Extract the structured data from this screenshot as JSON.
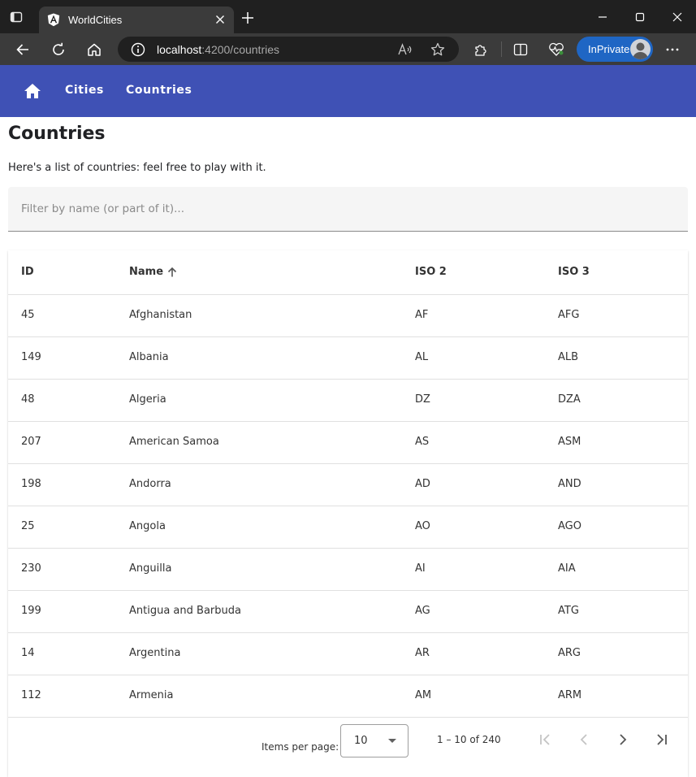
{
  "browser": {
    "tab_title": "WorldCities",
    "address_host": "localhost",
    "address_path": ":4200/countries",
    "inprivate_label": "InPrivate"
  },
  "icons": {
    "tab_actions": "tab-actions-icon",
    "favicon": "angular-logo-icon",
    "tab_close": "close-icon",
    "new_tab": "plus-icon",
    "minimize": "minimize-icon",
    "maximize": "maximize-icon",
    "close_window": "close-icon",
    "back": "arrow-left-icon",
    "refresh": "refresh-icon",
    "home": "home-icon",
    "site_info": "info-icon",
    "read_aloud": "read-aloud-icon",
    "favorite": "star-icon",
    "extensions": "puzzle-icon",
    "split_screen": "split-screen-icon",
    "health": "heartbeat-icon",
    "more": "more-horizontal-icon",
    "app_home": "home-icon",
    "sort": "arrow-up-icon",
    "dropdown": "caret-down-icon",
    "first_page": "first-page-icon",
    "prev_page": "chevron-left-icon",
    "next_page": "chevron-right-icon",
    "last_page": "last-page-icon"
  },
  "colors": {
    "appbar": "#3f51b5",
    "inprivate": "#1f66c4"
  },
  "nav": {
    "cities": "Cities",
    "countries": "Countries"
  },
  "page": {
    "title": "Countries",
    "intro": "Here's a list of countries: feel free to play with it."
  },
  "filter": {
    "placeholder": "Filter by name (or part of it)...",
    "value": ""
  },
  "table": {
    "columns": [
      "ID",
      "Name",
      "ISO 2",
      "ISO 3"
    ],
    "sort": {
      "column": "Name",
      "direction": "asc"
    },
    "rows": [
      [
        "45",
        "Afghanistan",
        "AF",
        "AFG"
      ],
      [
        "149",
        "Albania",
        "AL",
        "ALB"
      ],
      [
        "48",
        "Algeria",
        "DZ",
        "DZA"
      ],
      [
        "207",
        "American Samoa",
        "AS",
        "ASM"
      ],
      [
        "198",
        "Andorra",
        "AD",
        "AND"
      ],
      [
        "25",
        "Angola",
        "AO",
        "AGO"
      ],
      [
        "230",
        "Anguilla",
        "AI",
        "AIA"
      ],
      [
        "199",
        "Antigua and Barbuda",
        "AG",
        "ATG"
      ],
      [
        "14",
        "Argentina",
        "AR",
        "ARG"
      ],
      [
        "112",
        "Armenia",
        "AM",
        "ARM"
      ]
    ]
  },
  "paginator": {
    "items_per_page_label": "Items per page:",
    "page_size": "10",
    "range_label": "1 – 10 of 240"
  }
}
